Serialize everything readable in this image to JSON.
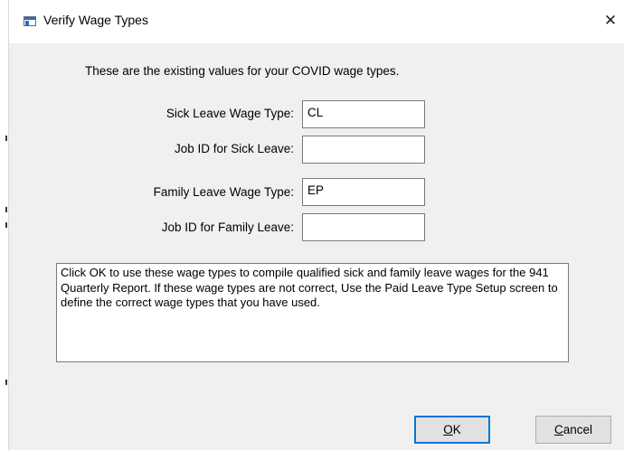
{
  "window": {
    "title": "Verify Wage Types",
    "close_symbol": "✕"
  },
  "intro_text": "These are the existing values for your COVID wage types.",
  "fields": {
    "sick_leave_wage_type": {
      "label": "Sick Leave Wage Type:",
      "value": "CL"
    },
    "job_id_sick_leave": {
      "label": "Job ID for Sick Leave:",
      "value": ""
    },
    "family_leave_wage_type": {
      "label": "Family Leave Wage Type:",
      "value": "EP"
    },
    "job_id_family_leave": {
      "label": "Job ID for Family Leave:",
      "value": ""
    }
  },
  "message": "Click OK to use these wage types to compile qualified sick and family leave wages for the 941 Quarterly Report. If these wage types are not correct, Use the Paid Leave Type Setup screen to define the correct wage types that you have used.",
  "buttons": {
    "ok": {
      "mnemonic": "O",
      "rest": "K"
    },
    "cancel": {
      "mnemonic": "C",
      "rest": "ancel"
    }
  },
  "icons": {
    "window_icon": "window-icon",
    "close": "close-icon"
  },
  "colors": {
    "accent": "#0078d7",
    "dialog_bg": "#f0f0f0",
    "titlebar_bg": "#ffffff"
  }
}
